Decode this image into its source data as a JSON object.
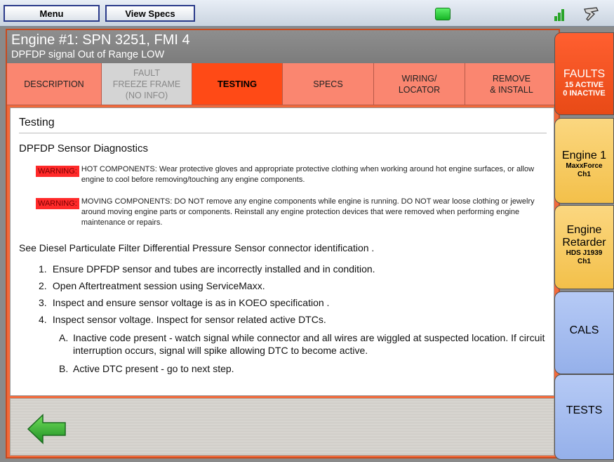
{
  "topbar": {
    "menu_label": "Menu",
    "view_specs_label": "View Specs",
    "status_icon": "status-led-icon",
    "signal_icon": "signal-strength-icon",
    "tool_icon": "adapter-tool-icon"
  },
  "header": {
    "title": "Engine #1: SPN 3251, FMI 4",
    "subtitle": "DPFDP signal Out of Range LOW"
  },
  "tabs": [
    {
      "label": "DESCRIPTION",
      "state": "normal"
    },
    {
      "label": "FAULT\nFREEZE FRAME\n(NO INFO)",
      "state": "disabled"
    },
    {
      "label": "TESTING",
      "state": "active"
    },
    {
      "label": "SPECS",
      "state": "normal"
    },
    {
      "label": "WIRING/\nLOCATOR",
      "state": "normal"
    },
    {
      "label": "REMOVE\n& INSTALL",
      "state": "normal"
    }
  ],
  "content": {
    "section_title": "Testing",
    "subsection_title": "DPFDP Sensor Diagnostics",
    "warnings": [
      {
        "badge": "WARNING:",
        "text": "HOT COMPONENTS: Wear protective gloves and appropriate protective clothing when working around hot engine surfaces, or allow engine to cool before removing/touching any engine components."
      },
      {
        "badge": "WARNING:",
        "text": "MOVING COMPONENTS: DO NOT remove any engine components while engine is running. DO NOT wear loose clothing or jewelry around moving engine parts or components. Reinstall any engine protection devices that were removed when performing engine maintenance or repairs."
      }
    ],
    "see_text": "See Diesel Particulate Filter Differential Pressure Sensor connector identification .",
    "steps": [
      {
        "num": "1.",
        "text": "Ensure DPFDP sensor and tubes are incorrectly installed and in condition."
      },
      {
        "num": "2.",
        "text": "Open Aftertreatment session using ServiceMaxx."
      },
      {
        "num": "3.",
        "text": "Inspect and ensure sensor voltage is as in KOEO specification ."
      },
      {
        "num": "4.",
        "text": "Inspect sensor voltage. Inspect for sensor related active DTCs."
      }
    ],
    "substeps": [
      {
        "letter": "A.",
        "text": "Inactive code present - watch signal while connector and all wires are wiggled at suspected location. If circuit interruption occurs, signal will spike allowing DTC to become active."
      },
      {
        "letter": "B.",
        "text": "Active DTC present - go to next step."
      }
    ]
  },
  "footer": {
    "back_icon": "back-arrow-icon"
  },
  "side_tabs": {
    "faults": {
      "title": "FAULTS",
      "line1": "15 ACTIVE",
      "line2": "0 INACTIVE"
    },
    "engine": {
      "title": "Engine 1",
      "line1": "MaxxForce",
      "line2": "Ch1"
    },
    "retarder": {
      "title_line1": "Engine",
      "title_line2": "Retarder",
      "line1": "HDS J1939",
      "line2": "Ch1"
    },
    "cals": {
      "title": "CALS"
    },
    "tests": {
      "title": "TESTS"
    }
  },
  "colors": {
    "accent_orange": "#f26a3b",
    "active_tab": "#ff4a16",
    "tab_salmon": "#fa8670",
    "warning_red": "#ff2a2a",
    "side_yellow": "#f3c04a",
    "side_blue": "#95b0ea",
    "back_green": "#3bb33b"
  }
}
